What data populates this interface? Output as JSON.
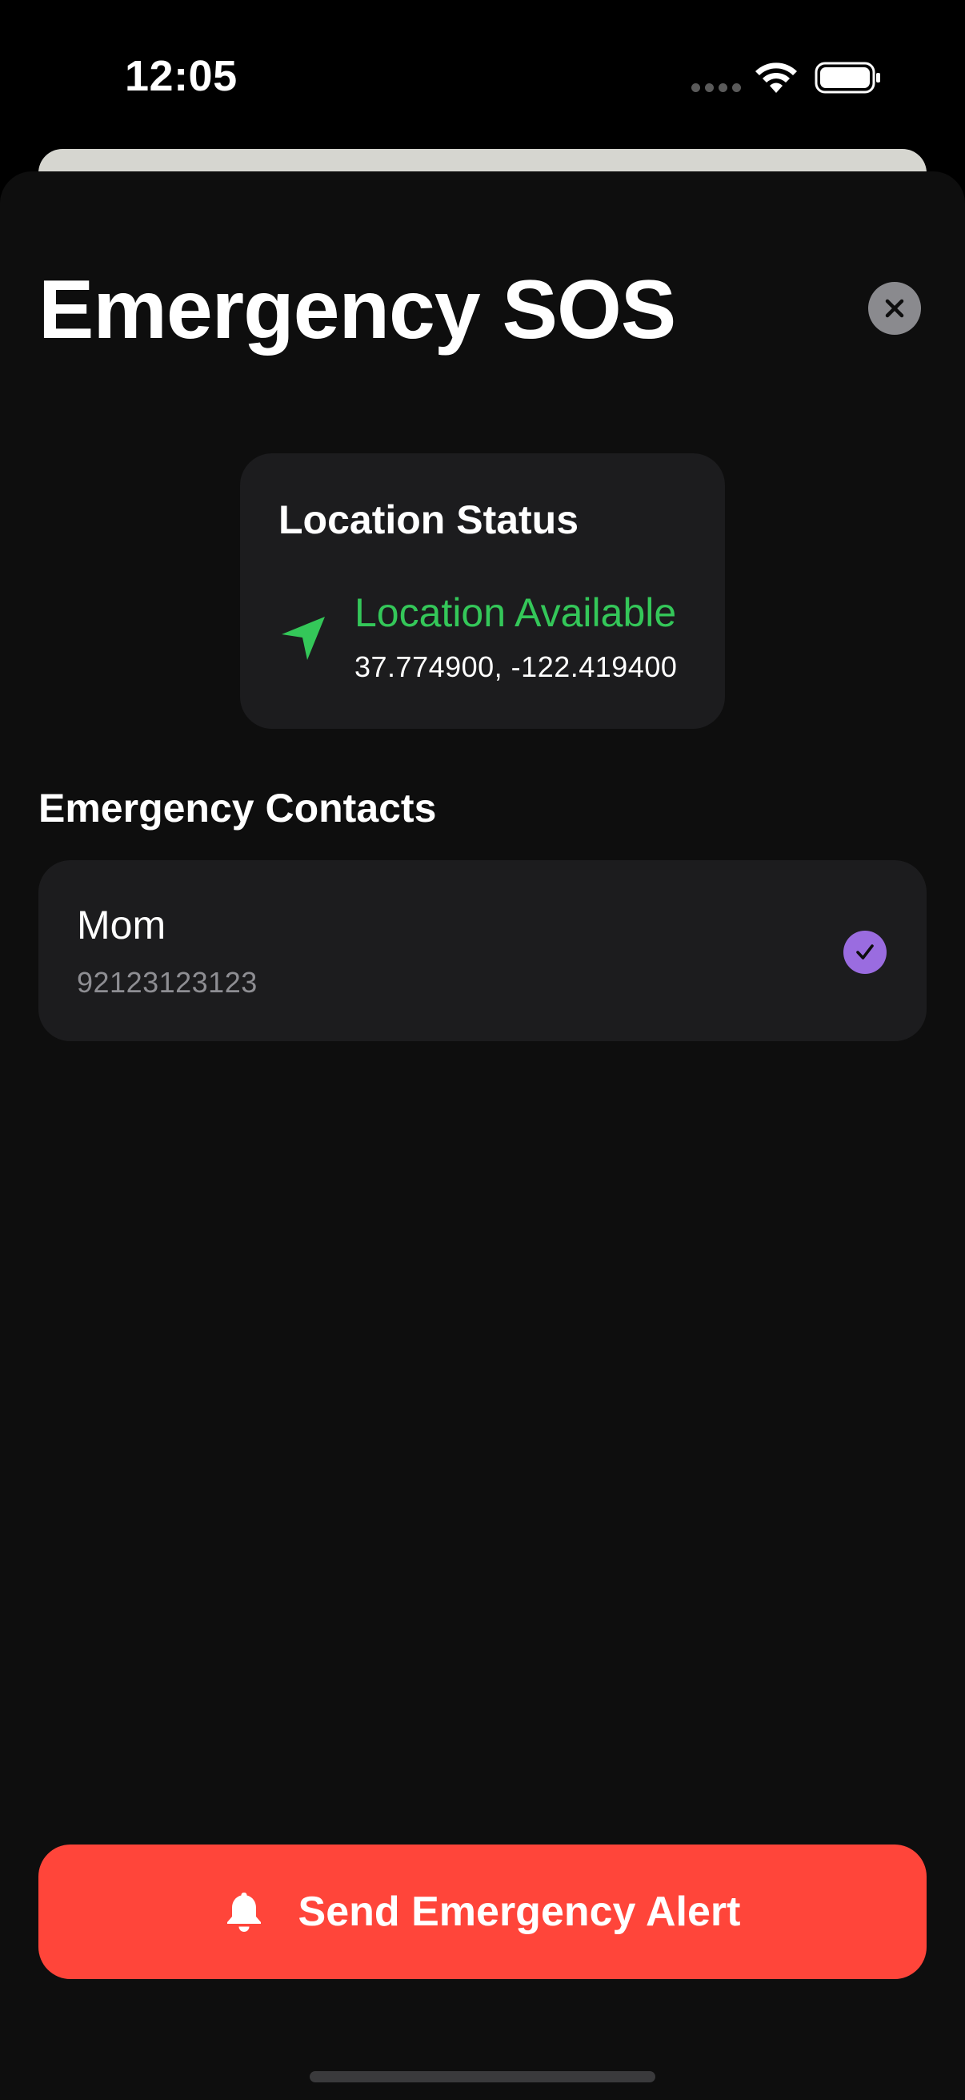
{
  "status_bar": {
    "time": "12:05"
  },
  "header": {
    "title": "Emergency SOS",
    "close_icon": "close-icon"
  },
  "location": {
    "title": "Location Status",
    "state": "Location Available",
    "coordinates": "37.774900, -122.419400",
    "icon": "location-arrow-icon",
    "status_color": "#34c759"
  },
  "contacts": {
    "heading": "Emergency Contacts",
    "items": [
      {
        "name": "Mom",
        "phone": "92123123123",
        "selected": true
      }
    ]
  },
  "actions": {
    "send_label": "Send Emergency Alert",
    "send_icon": "bell-icon",
    "send_color": "#ff453a"
  },
  "colors": {
    "accent_check": "#9a6ce0",
    "background": "#0e0e0e",
    "card": "#1c1c1e"
  }
}
